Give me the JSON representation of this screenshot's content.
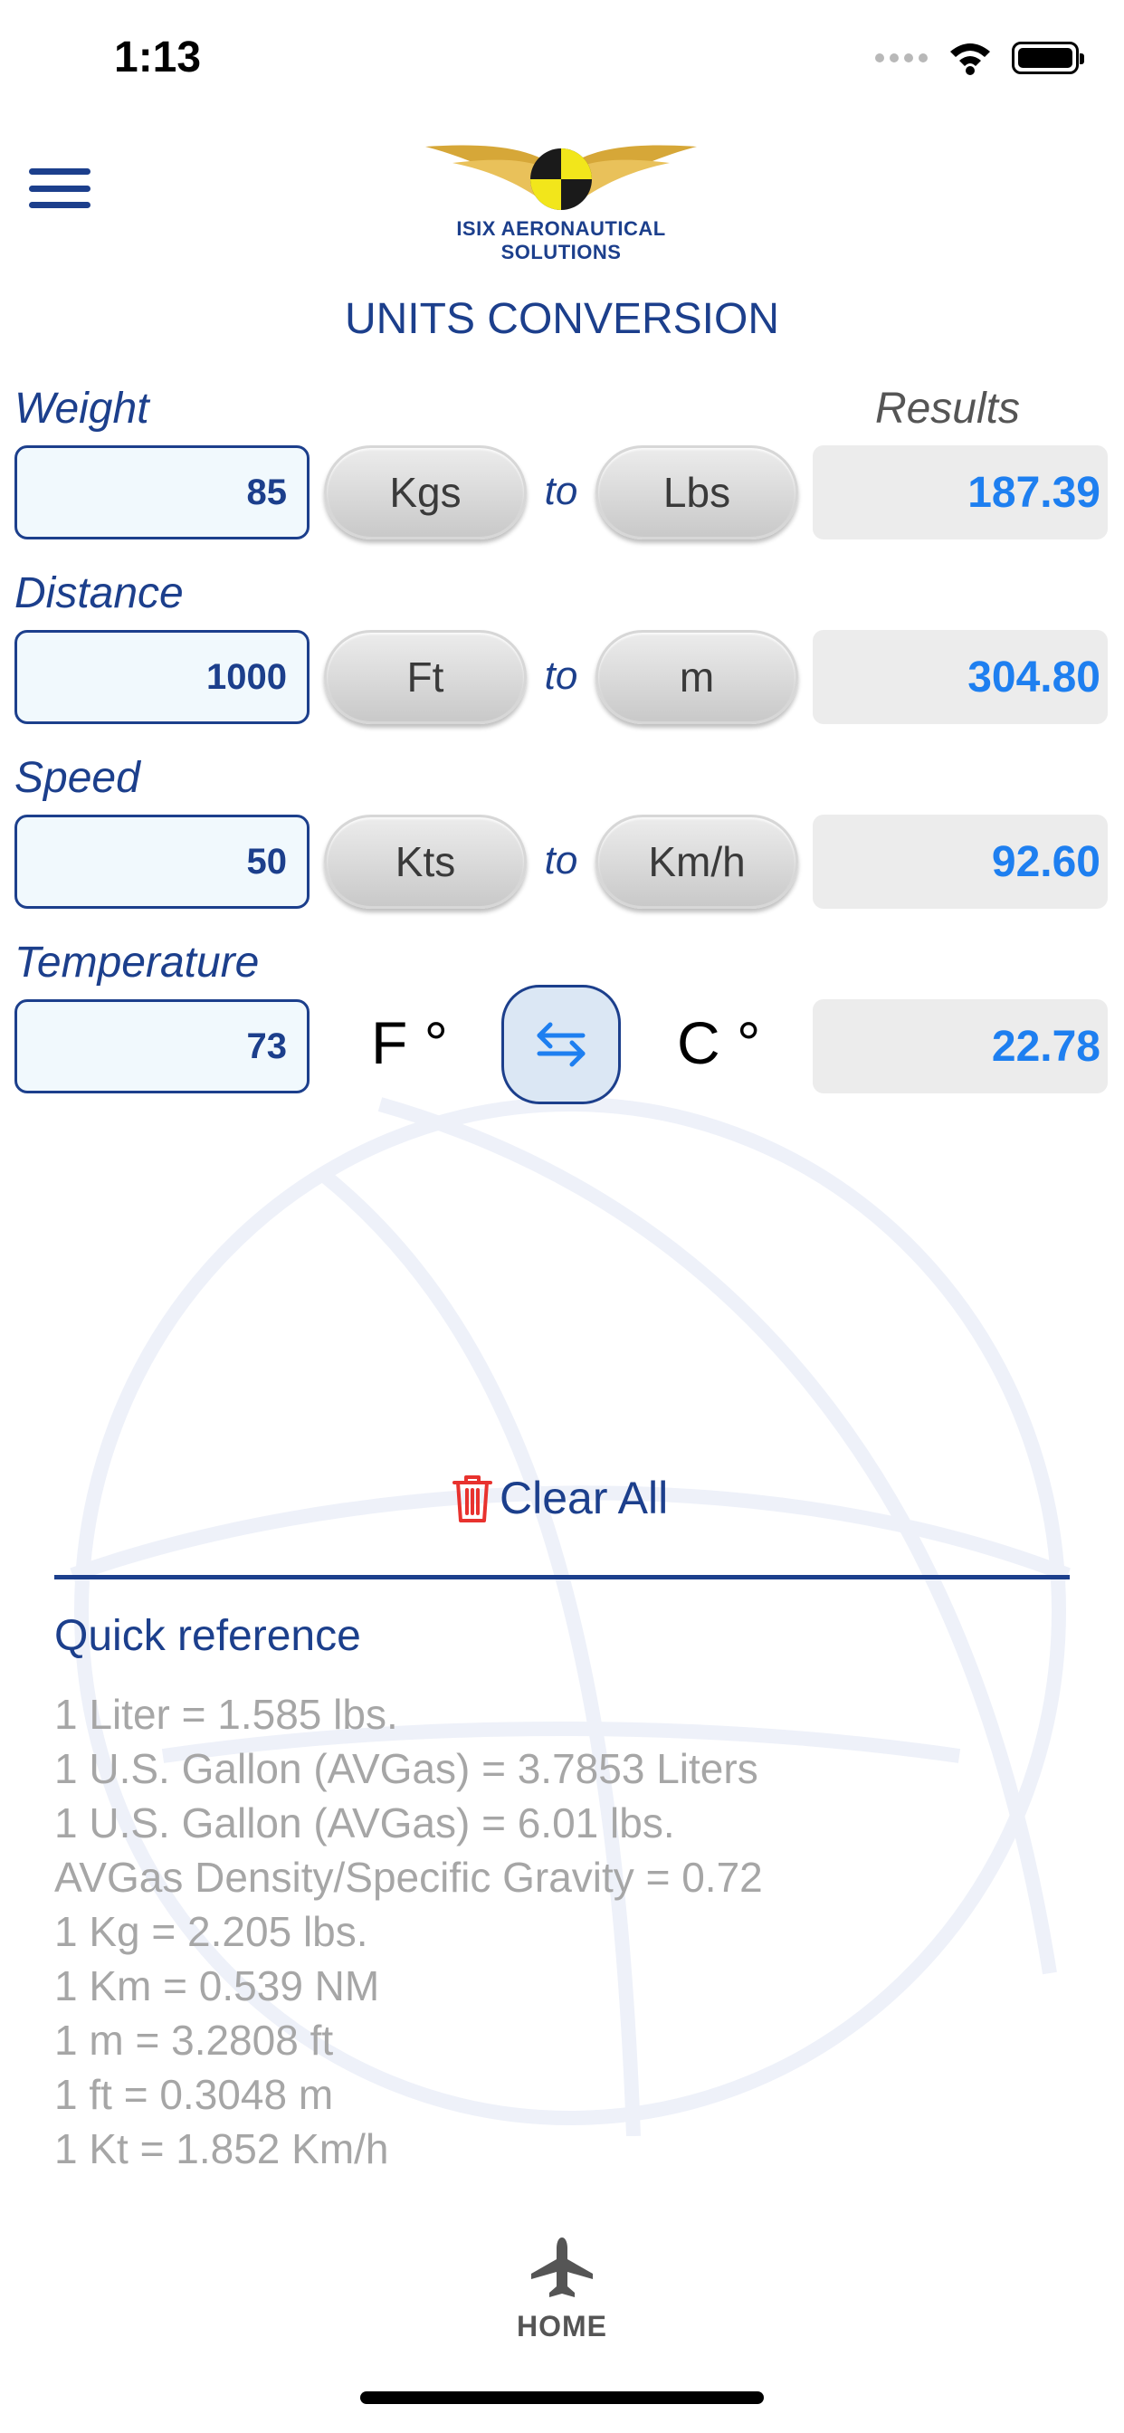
{
  "status_bar": {
    "time": "1:13"
  },
  "header": {
    "logo_text": "ISIX   AERONAUTICAL SOLUTIONS",
    "title": "UNITS CONVERSION"
  },
  "results_label": "Results",
  "weight": {
    "label": "Weight",
    "value": "85",
    "from_unit": "Kgs",
    "connector": "to",
    "to_unit": "Lbs",
    "result": "187.39"
  },
  "distance": {
    "label": "Distance",
    "value": "1000",
    "from_unit": "Ft",
    "connector": "to",
    "to_unit": "m",
    "result": "304.80"
  },
  "speed": {
    "label": "Speed",
    "value": "50",
    "from_unit": "Kts",
    "connector": "to",
    "to_unit": "Km/h",
    "result": "92.60"
  },
  "temperature": {
    "label": "Temperature",
    "value": "73",
    "from_unit": "F °",
    "to_unit": "C °",
    "result": "22.78"
  },
  "clear_all_label": "Clear All",
  "quick_reference": {
    "title": "Quick reference",
    "items": [
      "1  Liter = 1.585 lbs.",
      "1  U.S. Gallon (AVGas) = 3.7853 Liters",
      "1  U.S. Gallon (AVGas) = 6.01 lbs.",
      "AVGas Density/Specific Gravity = 0.72",
      "1  Kg = 2.205 lbs.",
      "1  Km = 0.539 NM",
      "1  m = 3.2808 ft",
      "1  ft = 0.3048 m",
      "1  Kt = 1.852 Km/h"
    ]
  },
  "tab_bar": {
    "home_label": "HOME"
  },
  "colors": {
    "primary": "#1c3f8c",
    "result_text": "#1e7ff0",
    "trash": "#e8322e"
  },
  "icons": {
    "menu": "hamburger-menu-icon",
    "swap": "swap-arrows-icon",
    "trash": "trash-icon",
    "home": "airplane-icon"
  }
}
